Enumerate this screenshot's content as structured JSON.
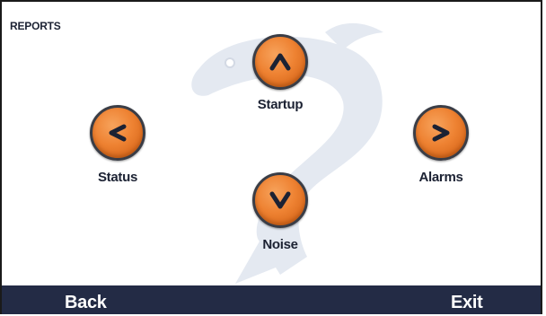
{
  "screen": {
    "title": "REPORTS"
  },
  "nav": {
    "up": {
      "label": "Startup",
      "icon": "chevron-up-icon"
    },
    "left": {
      "label": "Status",
      "icon": "chevron-left-icon"
    },
    "right": {
      "label": "Alarms",
      "icon": "chevron-right-icon"
    },
    "down": {
      "label": "Noise",
      "icon": "chevron-down-icon"
    }
  },
  "softkeys": {
    "back": "Back",
    "exit": "Exit"
  },
  "colors": {
    "accent": "#ee8232",
    "bar": "#232b45",
    "text": "#1c2233",
    "watermark": "#e3e8f0"
  }
}
